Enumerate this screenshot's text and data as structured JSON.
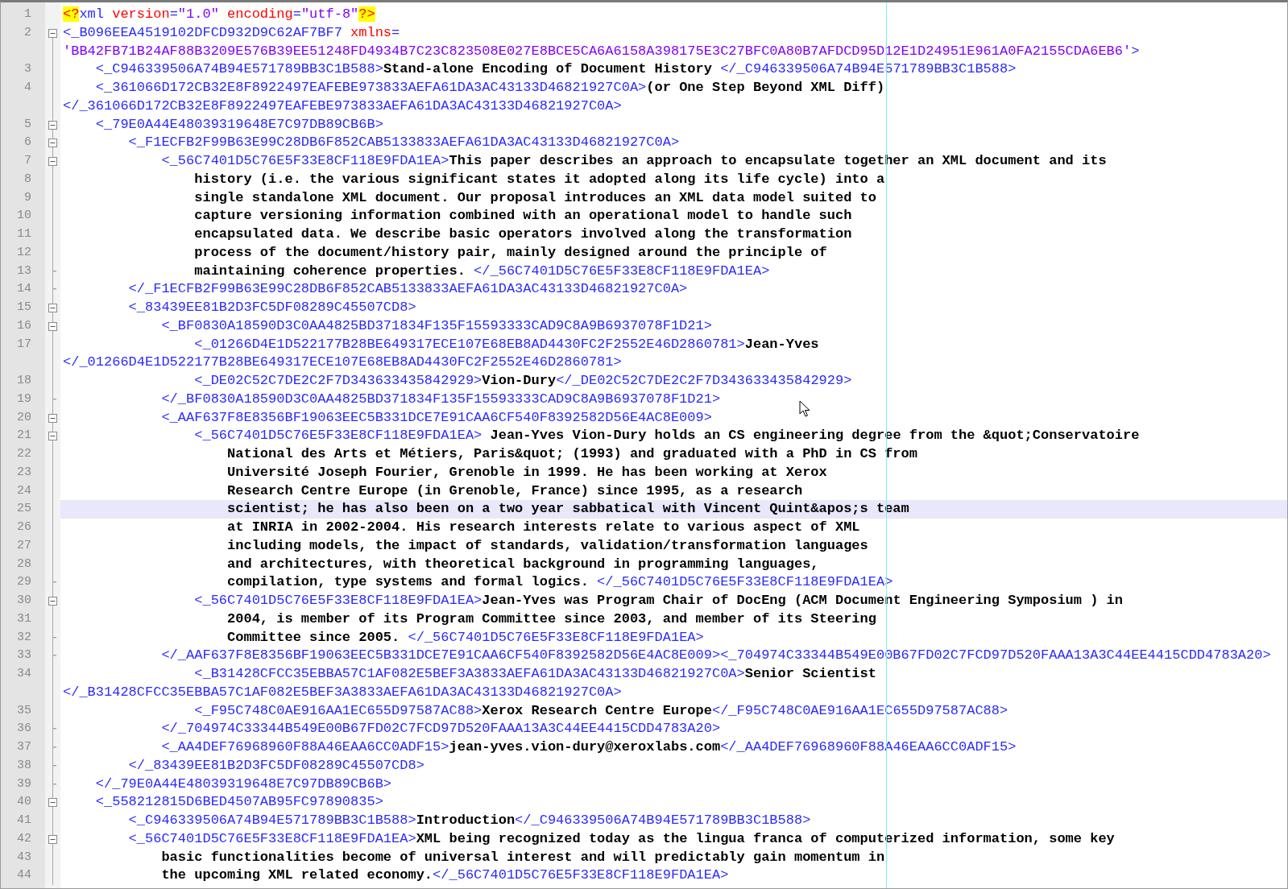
{
  "editor": {
    "lines": [
      {
        "number": "1",
        "kind": "plain",
        "current": false,
        "segments": [
          {
            "kind": "pi",
            "text": "<?"
          },
          {
            "kind": "tag",
            "text": "xml"
          },
          {
            "kind": "attr",
            "text": " version"
          },
          {
            "kind": "tag",
            "text": "="
          },
          {
            "kind": "value",
            "text": "\"1.0\""
          },
          {
            "kind": "attr",
            "text": " encoding"
          },
          {
            "kind": "tag",
            "text": "="
          },
          {
            "kind": "value",
            "text": "\"utf-8\""
          },
          {
            "kind": "pi",
            "text": "?>"
          }
        ]
      },
      {
        "number": "2",
        "kind": "opener",
        "current": false,
        "segments": [
          {
            "kind": "tag",
            "text": "<_B096EEA4519102DFCD932D9C62AF7BF7"
          },
          {
            "kind": "attr",
            "text": " xmlns"
          },
          {
            "kind": "tag",
            "text": "="
          }
        ]
      },
      {
        "kind": "plain",
        "current": false,
        "segments": [
          {
            "kind": "value",
            "text": "'BB42FB71B24AF88B3209E576B39EE51248FD4934B7C23C823508E027E8BCE5CA6A6158A398175E3C27BFC0A80B7AFDCD95D12E1D24951E961A0FA2155CDA6EB6'"
          },
          {
            "kind": "tag",
            "text": ">"
          }
        ]
      },
      {
        "number": "3",
        "kind": "plain",
        "current": false,
        "segments": [
          {
            "kind": "tag",
            "text": "    <_C946339506A74B94E571789BB3C1B588>"
          },
          {
            "kind": "text",
            "text": "Stand-alone Encoding of Document History "
          },
          {
            "kind": "tag",
            "text": "</_C946339506A74B94E571789BB3C1B588>"
          }
        ]
      },
      {
        "number": "4",
        "kind": "plain",
        "current": false,
        "segments": [
          {
            "kind": "tag",
            "text": "    <_361066D172CB32E8F8922497EAFEBE973833AEFA61DA3AC43133D46821927C0A>"
          },
          {
            "kind": "text",
            "text": "(or One Step Beyond XML Diff)"
          }
        ]
      },
      {
        "kind": "plain",
        "current": false,
        "segments": [
          {
            "kind": "tag",
            "text": "</_361066D172CB32E8F8922497EAFEBE973833AEFA61DA3AC43133D46821927C0A>"
          }
        ]
      },
      {
        "number": "5",
        "kind": "opener",
        "current": false,
        "segments": [
          {
            "kind": "tag",
            "text": "    <_79E0A44E48039319648E7C97DB89CB6B>"
          }
        ]
      },
      {
        "number": "6",
        "kind": "opener",
        "current": false,
        "segments": [
          {
            "kind": "tag",
            "text": "        <_F1ECFB2F99B63E99C28DB6F852CAB5133833AEFA61DA3AC43133D46821927C0A>"
          }
        ]
      },
      {
        "number": "7",
        "kind": "opener",
        "current": false,
        "segments": [
          {
            "kind": "tag",
            "text": "            <_56C7401D5C76E5F33E8CF118E9FDA1EA>"
          },
          {
            "kind": "text",
            "text": "This paper describes an approach to encapsulate together an XML document and its"
          }
        ]
      },
      {
        "number": "8",
        "kind": "plain",
        "current": false,
        "segments": [
          {
            "kind": "text",
            "text": "                history (i.e. the various significant states it adopted along its life cycle) into a"
          }
        ]
      },
      {
        "number": "9",
        "kind": "plain",
        "current": false,
        "segments": [
          {
            "kind": "text",
            "text": "                single standalone XML document. Our proposal introduces an XML data model suited to"
          }
        ]
      },
      {
        "number": "10",
        "kind": "plain",
        "current": false,
        "segments": [
          {
            "kind": "text",
            "text": "                capture versioning information combined with an operational model to handle such"
          }
        ]
      },
      {
        "number": "11",
        "kind": "plain",
        "current": false,
        "segments": [
          {
            "kind": "text",
            "text": "                encapsulated data. We describe basic operators involved along the transformation"
          }
        ]
      },
      {
        "number": "12",
        "kind": "plain",
        "current": false,
        "segments": [
          {
            "kind": "text",
            "text": "                process of the document/history pair, mainly designed around the principle of"
          }
        ]
      },
      {
        "number": "13",
        "kind": "closer",
        "current": false,
        "segments": [
          {
            "kind": "text",
            "text": "                maintaining coherence properties. "
          },
          {
            "kind": "tag",
            "text": "</_56C7401D5C76E5F33E8CF118E9FDA1EA>"
          }
        ]
      },
      {
        "number": "14",
        "kind": "closer",
        "current": false,
        "segments": [
          {
            "kind": "tag",
            "text": "        </_F1ECFB2F99B63E99C28DB6F852CAB5133833AEFA61DA3AC43133D46821927C0A>"
          }
        ]
      },
      {
        "number": "15",
        "kind": "opener",
        "current": false,
        "segments": [
          {
            "kind": "tag",
            "text": "        <_83439EE81B2D3FC5DF08289C45507CD8>"
          }
        ]
      },
      {
        "number": "16",
        "kind": "opener",
        "current": false,
        "segments": [
          {
            "kind": "tag",
            "text": "            <_BF0830A18590D3C0AA4825BD371834F135F15593333CAD9C8A9B6937078F1D21>"
          }
        ]
      },
      {
        "number": "17",
        "kind": "plain",
        "current": false,
        "segments": [
          {
            "kind": "tag",
            "text": "                <_01266D4E1D522177B28BE649317ECE107E68EB8AD4430FC2F2552E46D2860781>"
          },
          {
            "kind": "text",
            "text": "Jean-Yves"
          }
        ]
      },
      {
        "kind": "plain",
        "current": false,
        "segments": [
          {
            "kind": "tag",
            "text": "</_01266D4E1D522177B28BE649317ECE107E68EB8AD4430FC2F2552E46D2860781>"
          }
        ]
      },
      {
        "number": "18",
        "kind": "plain",
        "current": false,
        "segments": [
          {
            "kind": "tag",
            "text": "                <_DE02C52C7DE2C2F7D343633435842929>"
          },
          {
            "kind": "text",
            "text": "Vion-Dury"
          },
          {
            "kind": "tag",
            "text": "</_DE02C52C7DE2C2F7D343633435842929>"
          }
        ]
      },
      {
        "number": "19",
        "kind": "closer",
        "current": false,
        "segments": [
          {
            "kind": "tag",
            "text": "            </_BF0830A18590D3C0AA4825BD371834F135F15593333CAD9C8A9B6937078F1D21>"
          }
        ]
      },
      {
        "number": "20",
        "kind": "opener",
        "current": false,
        "segments": [
          {
            "kind": "tag",
            "text": "            <_AAF637F8E8356BF19063EEC5B331DCE7E91CAA6CF540F8392582D56E4AC8E009>"
          }
        ]
      },
      {
        "number": "21",
        "kind": "opener",
        "current": false,
        "segments": [
          {
            "kind": "tag",
            "text": "                <_56C7401D5C76E5F33E8CF118E9FDA1EA>"
          },
          {
            "kind": "text",
            "text": " Jean-Yves Vion-Dury holds an CS engineering degree from the &quot;Conservatoire"
          }
        ]
      },
      {
        "number": "22",
        "kind": "plain",
        "current": false,
        "segments": [
          {
            "kind": "text",
            "text": "                    National des Arts et Métiers, Paris&quot; (1993) and graduated with a PhD in CS from"
          }
        ]
      },
      {
        "number": "23",
        "kind": "plain",
        "current": false,
        "segments": [
          {
            "kind": "text",
            "text": "                    Université Joseph Fourier, Grenoble in 1999. He has been working at Xerox"
          }
        ]
      },
      {
        "number": "24",
        "kind": "plain",
        "current": false,
        "segments": [
          {
            "kind": "text",
            "text": "                    Research Centre Europe (in Grenoble, France) since 1995, as a research"
          }
        ]
      },
      {
        "number": "25",
        "kind": "plain",
        "current": true,
        "segments": [
          {
            "kind": "text",
            "text": "                    scientist; he has also been on a two year sabbatical with Vincent Quint&apos;s team"
          }
        ]
      },
      {
        "number": "26",
        "kind": "plain",
        "current": false,
        "segments": [
          {
            "kind": "text",
            "text": "                    at INRIA in 2002-2004. His research interests relate to various aspect of XML"
          }
        ]
      },
      {
        "number": "27",
        "kind": "plain",
        "current": false,
        "segments": [
          {
            "kind": "text",
            "text": "                    including models, the impact of standards, validation/transformation languages"
          }
        ]
      },
      {
        "number": "28",
        "kind": "plain",
        "current": false,
        "segments": [
          {
            "kind": "text",
            "text": "                    and architectures, with theoretical background in programming languages,"
          }
        ]
      },
      {
        "number": "29",
        "kind": "closer",
        "current": false,
        "segments": [
          {
            "kind": "text",
            "text": "                    compilation, type systems and formal logics. "
          },
          {
            "kind": "tag",
            "text": "</_56C7401D5C76E5F33E8CF118E9FDA1EA>"
          }
        ]
      },
      {
        "number": "30",
        "kind": "opener",
        "current": false,
        "segments": [
          {
            "kind": "tag",
            "text": "                <_56C7401D5C76E5F33E8CF118E9FDA1EA>"
          },
          {
            "kind": "text",
            "text": "Jean-Yves was Program Chair of DocEng (ACM Document Engineering Symposium ) in"
          }
        ]
      },
      {
        "number": "31",
        "kind": "plain",
        "current": false,
        "segments": [
          {
            "kind": "text",
            "text": "                    2004, is member of its Program Committee since 2003, and member of its Steering"
          }
        ]
      },
      {
        "number": "32",
        "kind": "closer",
        "current": false,
        "segments": [
          {
            "kind": "text",
            "text": "                    Committee since 2005. "
          },
          {
            "kind": "tag",
            "text": "</_56C7401D5C76E5F33E8CF118E9FDA1EA>"
          }
        ]
      },
      {
        "number": "33",
        "kind": "closer",
        "current": false,
        "segments": [
          {
            "kind": "tag",
            "text": "            </_AAF637F8E8356BF19063EEC5B331DCE7E91CAA6CF540F8392582D56E4AC8E009><_704974C33344B549E00B67FD02C7FCD97D520FAAA13A3C44EE4415CDD4783A20>"
          }
        ]
      },
      {
        "number": "34",
        "kind": "plain",
        "current": false,
        "segments": [
          {
            "kind": "tag",
            "text": "                <_B31428CFCC35EBBA57C1AF082E5BEF3A3833AEFA61DA3AC43133D46821927C0A>"
          },
          {
            "kind": "text",
            "text": "Senior Scientist"
          }
        ]
      },
      {
        "kind": "plain",
        "current": false,
        "segments": [
          {
            "kind": "tag",
            "text": "</_B31428CFCC35EBBA57C1AF082E5BEF3A3833AEFA61DA3AC43133D46821927C0A>"
          }
        ]
      },
      {
        "number": "35",
        "kind": "plain",
        "current": false,
        "segments": [
          {
            "kind": "tag",
            "text": "                <_F95C748C0AE916AA1EC655D97587AC88>"
          },
          {
            "kind": "text",
            "text": "Xerox Research Centre Europe"
          },
          {
            "kind": "tag",
            "text": "</_F95C748C0AE916AA1EC655D97587AC88>"
          }
        ]
      },
      {
        "number": "36",
        "kind": "closer",
        "current": false,
        "segments": [
          {
            "kind": "tag",
            "text": "            </_704974C33344B549E00B67FD02C7FCD97D520FAAA13A3C44EE4415CDD4783A20>"
          }
        ]
      },
      {
        "number": "37",
        "kind": "closer",
        "current": false,
        "segments": [
          {
            "kind": "tag",
            "text": "            <_AA4DEF76968960F88A46EAA6CC0ADF15>"
          },
          {
            "kind": "text",
            "text": "jean-yves.vion-dury@xeroxlabs.com"
          },
          {
            "kind": "tag",
            "text": "</_AA4DEF76968960F88A46EAA6CC0ADF15>"
          }
        ]
      },
      {
        "number": "38",
        "kind": "closer",
        "current": false,
        "segments": [
          {
            "kind": "tag",
            "text": "        </_83439EE81B2D3FC5DF08289C45507CD8>"
          }
        ]
      },
      {
        "number": "39",
        "kind": "closer",
        "current": false,
        "segments": [
          {
            "kind": "tag",
            "text": "    </_79E0A44E48039319648E7C97DB89CB6B>"
          }
        ]
      },
      {
        "number": "40",
        "kind": "opener",
        "current": false,
        "segments": [
          {
            "kind": "tag",
            "text": "    <_558212815D6BED4507AB95FC97890835>"
          }
        ]
      },
      {
        "number": "41",
        "kind": "plain",
        "current": false,
        "segments": [
          {
            "kind": "tag",
            "text": "        <_C946339506A74B94E571789BB3C1B588>"
          },
          {
            "kind": "text",
            "text": "Introduction"
          },
          {
            "kind": "tag",
            "text": "</_C946339506A74B94E571789BB3C1B588>"
          }
        ]
      },
      {
        "number": "42",
        "kind": "opener",
        "current": false,
        "segments": [
          {
            "kind": "tag",
            "text": "        <_56C7401D5C76E5F33E8CF118E9FDA1EA>"
          },
          {
            "kind": "text",
            "text": "XML being recognized today as the lingua franca of computerized information, some key"
          }
        ]
      },
      {
        "number": "43",
        "kind": "plain",
        "current": false,
        "segments": [
          {
            "kind": "text",
            "text": "            basic functionalities become of universal interest and will predictably gain momentum in"
          }
        ]
      },
      {
        "number": "44",
        "kind": "plain",
        "current": false,
        "segments": [
          {
            "kind": "text",
            "text": "            the upcoming XML related economy."
          },
          {
            "kind": "tag",
            "text": "</_56C7401D5C76E5F33E8CF118E9FDA1EA>"
          }
        ]
      }
    ]
  }
}
